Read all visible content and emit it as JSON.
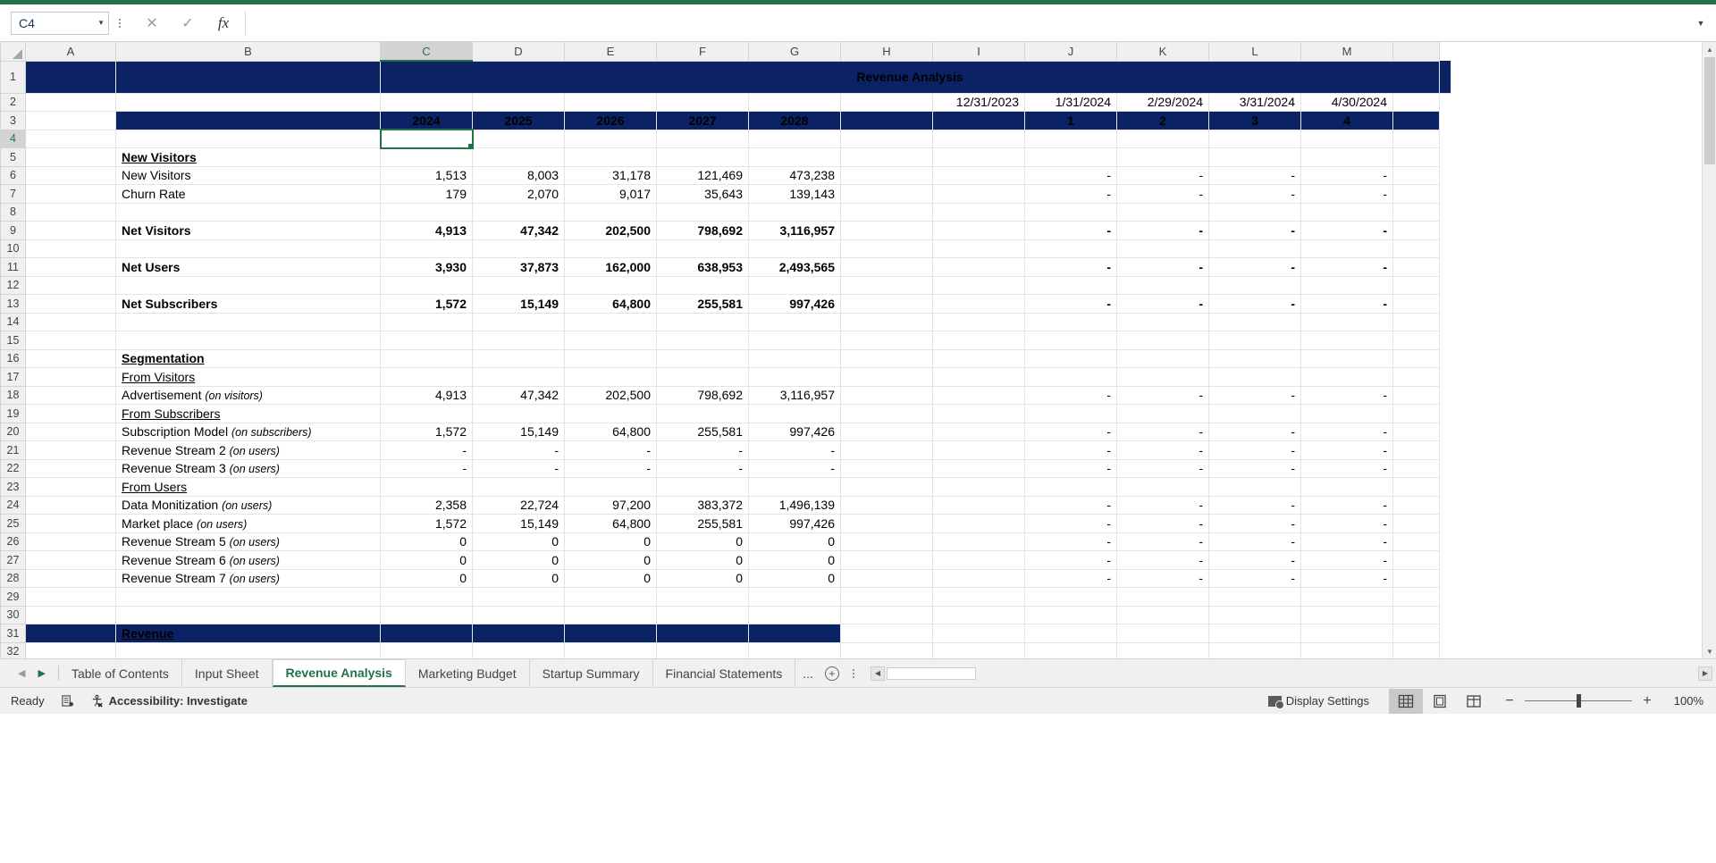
{
  "namebox": {
    "value": "C4",
    "caret": "chevron-down-icon"
  },
  "formula_bar": {
    "cancel": "✕",
    "confirm": "✓",
    "fx": "fx",
    "value": "",
    "expand": "⌄"
  },
  "colors": {
    "navy": "#0b2265",
    "excel_green": "#217346",
    "selection": "#217346"
  },
  "columns": [
    "A",
    "B",
    "C",
    "D",
    "E",
    "F",
    "G",
    "H",
    "I",
    "J",
    "K",
    "L",
    "M"
  ],
  "selected_column": "C",
  "selected_cell": "C4",
  "rows": [
    "1",
    "2",
    "3",
    "4",
    "5",
    "6",
    "7",
    "8",
    "9",
    "10",
    "11",
    "12",
    "13",
    "14",
    "15",
    "16",
    "17",
    "18",
    "19",
    "20",
    "21",
    "22",
    "23",
    "24",
    "25",
    "26",
    "27",
    "28",
    "29",
    "30",
    "31",
    "32"
  ],
  "selected_row": "4",
  "sheet": {
    "title": "Revenue Analysis",
    "dates_row": {
      "label": "",
      "values": [
        "12/31/2023",
        "1/31/2024",
        "2/29/2024",
        "3/31/2024",
        "4/30/2024"
      ]
    },
    "year_header": {
      "years": [
        "2024",
        "2025",
        "2026",
        "2027",
        "2028"
      ],
      "months": [
        "1",
        "2",
        "3",
        "4"
      ]
    },
    "rows_data": [
      {
        "row": "5",
        "label": "New Visitors",
        "style": "bold-underline",
        "suffix": "",
        "values": [],
        "right": []
      },
      {
        "row": "6",
        "label": "New Visitors",
        "style": "normal",
        "suffix": "",
        "values": [
          "1,513",
          "8,003",
          "31,178",
          "121,469",
          "473,238"
        ],
        "right": [
          "-",
          "-",
          "-",
          "-"
        ]
      },
      {
        "row": "7",
        "label": "Churn Rate",
        "style": "normal",
        "suffix": "",
        "values": [
          "179",
          "2,070",
          "9,017",
          "35,643",
          "139,143"
        ],
        "right": [
          "-",
          "-",
          "-",
          "-"
        ]
      },
      {
        "row": "8",
        "label": "",
        "style": "normal",
        "suffix": "",
        "values": [],
        "right": []
      },
      {
        "row": "9",
        "label": "Net Visitors",
        "style": "bold",
        "suffix": "",
        "values": [
          "4,913",
          "47,342",
          "202,500",
          "798,692",
          "3,116,957"
        ],
        "right": [
          "-",
          "-",
          "-",
          "-"
        ]
      },
      {
        "row": "10",
        "label": "",
        "style": "normal",
        "suffix": "",
        "values": [],
        "right": []
      },
      {
        "row": "11",
        "label": "Net Users",
        "style": "bold",
        "suffix": "",
        "values": [
          "3,930",
          "37,873",
          "162,000",
          "638,953",
          "2,493,565"
        ],
        "right": [
          "-",
          "-",
          "-",
          "-"
        ]
      },
      {
        "row": "12",
        "label": "",
        "style": "normal",
        "suffix": "",
        "values": [],
        "right": []
      },
      {
        "row": "13",
        "label": "Net Subscribers",
        "style": "bold",
        "suffix": "",
        "values": [
          "1,572",
          "15,149",
          "64,800",
          "255,581",
          "997,426"
        ],
        "right": [
          "-",
          "-",
          "-",
          "-"
        ]
      },
      {
        "row": "14",
        "label": "",
        "style": "normal",
        "suffix": "",
        "values": [],
        "right": []
      },
      {
        "row": "15",
        "label": "",
        "style": "normal",
        "suffix": "",
        "values": [],
        "right": []
      },
      {
        "row": "16",
        "label": "Segmentation",
        "style": "bold-underline",
        "suffix": "",
        "values": [],
        "right": []
      },
      {
        "row": "17",
        "label": "From Visitors",
        "style": "underline",
        "suffix": "",
        "values": [],
        "right": []
      },
      {
        "row": "18",
        "label": "Advertisement ",
        "style": "normal",
        "suffix": "(on visitors)",
        "values": [
          "4,913",
          "47,342",
          "202,500",
          "798,692",
          "3,116,957"
        ],
        "right": [
          "-",
          "-",
          "-",
          "-"
        ]
      },
      {
        "row": "19",
        "label": "From Subscribers",
        "style": "underline",
        "suffix": "",
        "values": [],
        "right": []
      },
      {
        "row": "20",
        "label": "Subscription Model ",
        "style": "normal",
        "suffix": "(on subscribers)",
        "values": [
          "1,572",
          "15,149",
          "64,800",
          "255,581",
          "997,426"
        ],
        "right": [
          "-",
          "-",
          "-",
          "-"
        ]
      },
      {
        "row": "21",
        "label": "Revenue Stream 2 ",
        "style": "normal",
        "suffix": "(on users)",
        "values": [
          "-",
          "-",
          "-",
          "-",
          "-"
        ],
        "right": [
          "-",
          "-",
          "-",
          "-"
        ]
      },
      {
        "row": "22",
        "label": "Revenue Stream 3 ",
        "style": "normal",
        "suffix": "(on users)",
        "values": [
          "-",
          "-",
          "-",
          "-",
          "-"
        ],
        "right": [
          "-",
          "-",
          "-",
          "-"
        ]
      },
      {
        "row": "23",
        "label": "From Users",
        "style": "underline",
        "suffix": "",
        "values": [],
        "right": []
      },
      {
        "row": "24",
        "label": "Data Monitization ",
        "style": "normal",
        "suffix": "(on users)",
        "values": [
          "2,358",
          "22,724",
          "97,200",
          "383,372",
          "1,496,139"
        ],
        "right": [
          "-",
          "-",
          "-",
          "-"
        ]
      },
      {
        "row": "25",
        "label": "Market place ",
        "style": "normal",
        "suffix": "(on users)",
        "values": [
          "1,572",
          "15,149",
          "64,800",
          "255,581",
          "997,426"
        ],
        "right": [
          "-",
          "-",
          "-",
          "-"
        ]
      },
      {
        "row": "26",
        "label": "Revenue Stream 5 ",
        "style": "normal",
        "suffix": "(on users)",
        "values": [
          "0",
          "0",
          "0",
          "0",
          "0"
        ],
        "right": [
          "-",
          "-",
          "-",
          "-"
        ]
      },
      {
        "row": "27",
        "label": "Revenue Stream 6 ",
        "style": "normal",
        "suffix": "(on users)",
        "values": [
          "0",
          "0",
          "0",
          "0",
          "0"
        ],
        "right": [
          "-",
          "-",
          "-",
          "-"
        ]
      },
      {
        "row": "28",
        "label": "Revenue Stream 7 ",
        "style": "normal",
        "suffix": "(on users)",
        "values": [
          "0",
          "0",
          "0",
          "0",
          "0"
        ],
        "right": [
          "-",
          "-",
          "-",
          "-"
        ]
      },
      {
        "row": "29",
        "label": "",
        "style": "normal",
        "suffix": "",
        "values": [],
        "right": []
      },
      {
        "row": "30",
        "label": "",
        "style": "normal",
        "suffix": "",
        "values": [],
        "right": []
      },
      {
        "row": "31",
        "label": "Revenue",
        "style": "navy-banner",
        "suffix": "",
        "values": [],
        "right": []
      },
      {
        "row": "32",
        "label": "",
        "style": "normal",
        "suffix": "",
        "values": [],
        "right": []
      }
    ]
  },
  "tabs": {
    "nav_prev": "◀",
    "nav_next": "▶",
    "items": [
      {
        "label": "Table of Contents",
        "active": false
      },
      {
        "label": "Input Sheet",
        "active": false
      },
      {
        "label": "Revenue Analysis",
        "active": true
      },
      {
        "label": "Marketing Budget",
        "active": false
      },
      {
        "label": "Startup Summary",
        "active": false
      },
      {
        "label": "Financial Statements",
        "active": false
      }
    ],
    "ellipsis": "...",
    "add_sheet": "+"
  },
  "status": {
    "ready": "Ready",
    "macro_icon": "record-macro-icon",
    "accessibility": "Accessibility: Investigate",
    "display_settings": "Display Settings",
    "zoom_level": "100%",
    "zoom_minus": "−",
    "zoom_plus": "+",
    "views": [
      "normal-view-icon",
      "page-layout-icon",
      "page-break-icon"
    ]
  }
}
